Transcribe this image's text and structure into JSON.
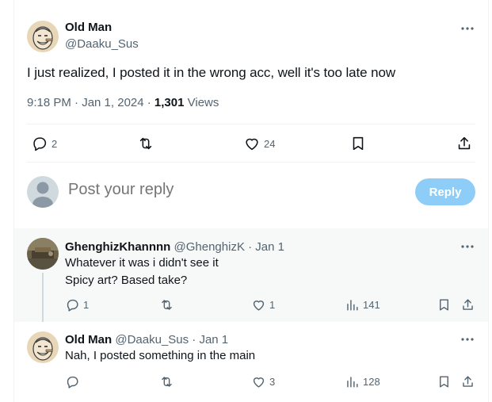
{
  "post": {
    "author_name": "Old Man",
    "author_handle": "@Daaku_Sus",
    "text": "I just realized, I posted it in the wrong acc, well it's too late now",
    "time": "9:18 PM · Jan 1, 2024 · ",
    "views_count": "1,301",
    "views_label": " Views",
    "reply_count": "2",
    "like_count": "24"
  },
  "composer": {
    "placeholder": "Post your reply",
    "button_label": "Reply"
  },
  "replies": [
    {
      "author_name": "GhenghizKhannnn",
      "author_handle": "@GhenghizK · Jan 1",
      "lines": [
        "Whatever it was i didn't see it",
        "Spicy art? Based take?"
      ],
      "reply_count": "1",
      "like_count": "1",
      "views": "141"
    },
    {
      "author_name": "Old Man",
      "author_handle": "@Daaku_Sus · Jan 1",
      "lines": [
        "Nah, I posted something in the main"
      ],
      "reply_count": "",
      "like_count": "3",
      "views": "128"
    }
  ],
  "icons": {
    "more": "more-icon",
    "reply": "reply-icon",
    "repost": "repost-icon",
    "like": "heart-icon",
    "bookmark": "bookmark-icon",
    "share": "share-icon",
    "views": "views-icon"
  },
  "colors": {
    "reply_button": "#8ecdf8",
    "secondary_text": "#536471",
    "primary_text": "#0f1419"
  }
}
